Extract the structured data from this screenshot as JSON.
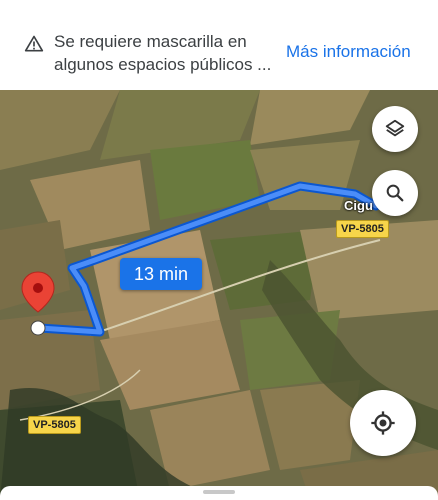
{
  "alert": {
    "line1": "Se requiere mascarilla en",
    "line2": "algunos espacios públicos ...",
    "link": "Más información",
    "icon": "warning-icon"
  },
  "map": {
    "route_duration": "13 min",
    "town_label": "Cigu",
    "road_labels": [
      "VP-5805",
      "VP-5805"
    ],
    "route_color": "#1a73e8"
  },
  "controls": {
    "layers_icon": "layers-icon",
    "search_icon": "search-icon",
    "location_icon": "my-location-icon"
  }
}
